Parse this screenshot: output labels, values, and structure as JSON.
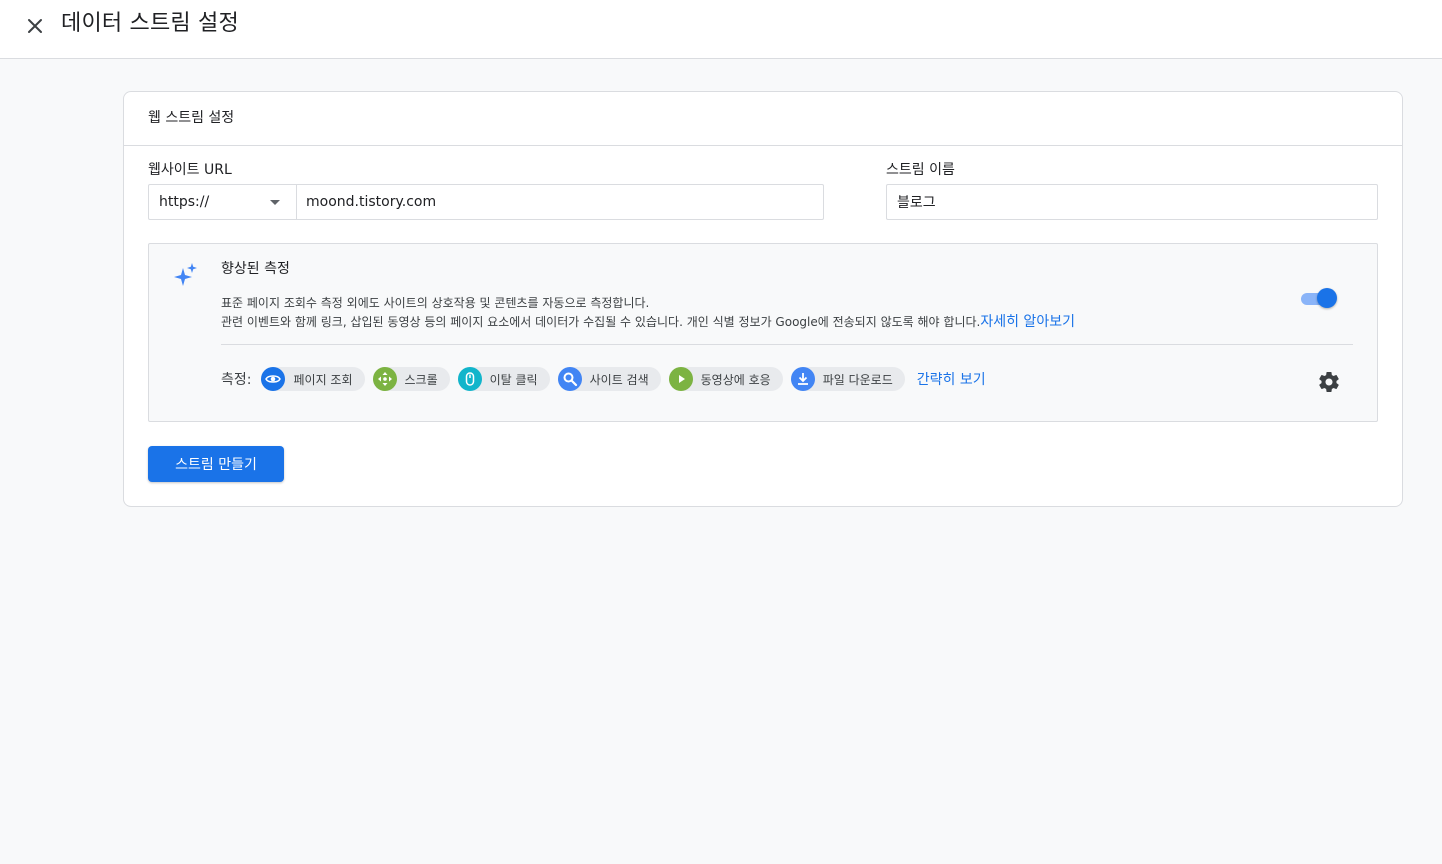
{
  "header": {
    "title": "데이터 스트림 설정",
    "close_icon": "close-icon"
  },
  "card": {
    "title": "웹 스트림 설정",
    "website_url": {
      "label": "웹사이트 URL",
      "protocol": "https://",
      "value": "moond.tistory.com"
    },
    "stream_name": {
      "label": "스트림 이름",
      "value": "블로그"
    },
    "enhanced": {
      "icon": "sparkle-icon",
      "title": "향상된 측정",
      "description_line1": "표준 페이지 조회수 측정 외에도 사이트의 상호작용 및 콘텐츠를 자동으로 측정합니다.",
      "description_line2": "관련 이벤트와 함께 링크, 삽입된 동영상 등의 페이지 요소에서 데이터가 수집될 수 있습니다. 개인 식별 정보가 Google에 전송되지 않도록 해야 합니다.",
      "learn_more": "자세히 알아보기",
      "toggle_on": true,
      "measure_label": "측정:",
      "chips": [
        {
          "label": "페이지 조회",
          "icon": "eye-icon",
          "color": "#1a73e8"
        },
        {
          "label": "스크롤",
          "icon": "scroll-arrows-icon",
          "color": "#7cb342"
        },
        {
          "label": "이탈 클릭",
          "icon": "mouse-icon",
          "color": "#12b5cb"
        },
        {
          "label": "사이트 검색",
          "icon": "search-icon",
          "color": "#4285f4"
        },
        {
          "label": "동영상에 호응",
          "icon": "play-icon",
          "color": "#7cb342"
        },
        {
          "label": "파일 다운로드",
          "icon": "download-icon",
          "color": "#4285f4"
        }
      ],
      "summary_link": "간략히 보기",
      "settings_icon": "gear-icon"
    },
    "create_button": "스트림 만들기"
  }
}
